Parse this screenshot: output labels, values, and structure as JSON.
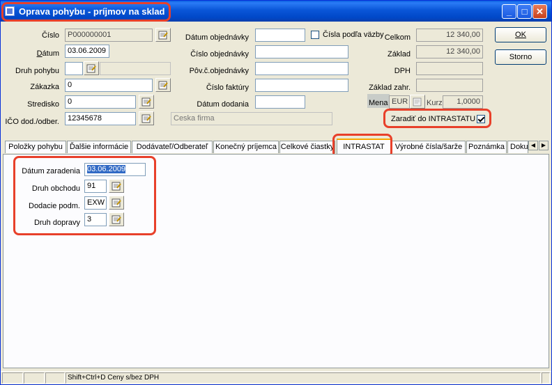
{
  "window": {
    "title": "Oprava pohybu - príjmov na sklad"
  },
  "left": {
    "cislo_label": "Číslo",
    "cislo_value": "P000000001",
    "datum_label": "Dátum",
    "datum_value": "03.06.2009",
    "druh_pohybu_label": "Druh pohybu",
    "druh_pohybu_value": "",
    "zakazka_label": "Zákazka",
    "zakazka_value": "0",
    "stredisko_label": "Stredisko",
    "stredisko_value": "0",
    "ico_label": "IČO dod./odber.",
    "ico_value": "12345678",
    "firm_name": "Ceska firma"
  },
  "middle": {
    "datum_obj_label": "Dátum objednávky",
    "datum_obj_value": "",
    "cisla_vazby_label": "Čísla podľa väzby",
    "cislo_obj_label": "Číslo objednávky",
    "cislo_obj_value": "",
    "pov_obj_label": "Pôv.č.objednávky",
    "pov_obj_value": "",
    "cislo_fakt_label": "Číslo faktúry",
    "cislo_fakt_value": "",
    "datum_dod_label": "Dátum dodania",
    "datum_dod_value": ""
  },
  "right": {
    "celkom_label": "Celkom",
    "celkom_value": "12 340,00",
    "zaklad_label": "Základ",
    "zaklad_value": "12 340,00",
    "dph_label": "DPH",
    "dph_value": "",
    "zaklad_zahr_label": "Základ zahr.",
    "zaklad_zahr_value": "",
    "mena_label": "Mena",
    "mena_value": "EUR",
    "kurz_label": "Kurz",
    "kurz_value": "1,0000",
    "intrastat_check_label": "Zaradiť do INTRASTATU"
  },
  "buttons": {
    "ok": "OK",
    "storno": "Storno"
  },
  "tabs": [
    "Položky pohybu",
    "Ďalšie informácie",
    "Dodávateľ/Odberateľ",
    "Konečný príjemca",
    "Celkové čiastky",
    "INTRASTAT",
    "Výrobné čísla/šarže",
    "Poznámka",
    "Doku"
  ],
  "intrastat": {
    "datum_zar_label": "Dátum zaradenia",
    "datum_zar_value": "03.06.2009",
    "druh_obchodu_label": "Druh obchodu",
    "druh_obchodu_value": "91",
    "dodacie_label": "Dodacie podm.",
    "dodacie_value": "EXW",
    "druh_dopravy_label": "Druh dopravy",
    "druh_dopravy_value": "3"
  },
  "status": {
    "hint": "Shift+Ctrl+D Ceny s/bez DPH"
  }
}
